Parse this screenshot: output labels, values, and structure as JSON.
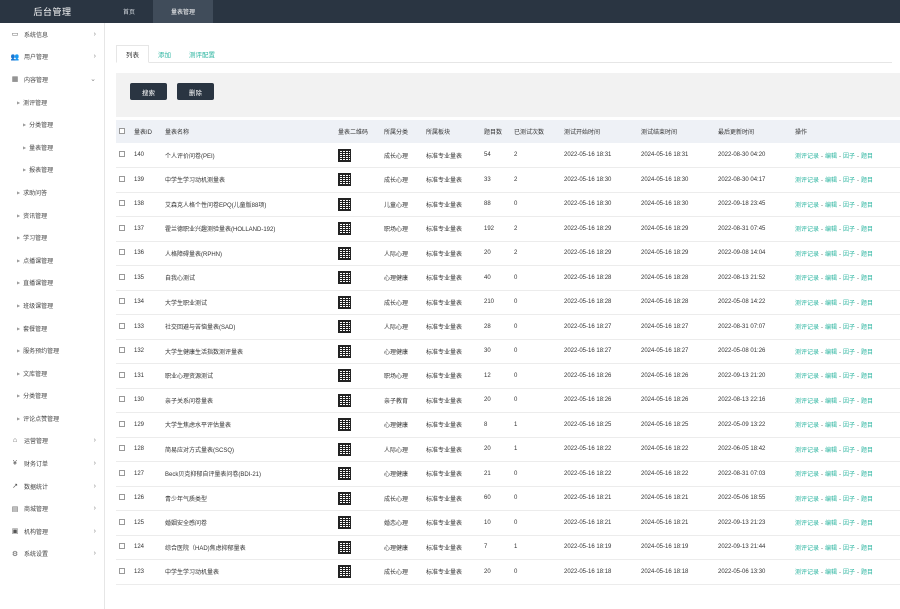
{
  "brand": "后台管理",
  "top_tabs": [
    "首页",
    "量表管理"
  ],
  "sidebar": {
    "top": [
      {
        "label": "系统信息",
        "icon": "monitor-icon",
        "glyph": "▭"
      },
      {
        "label": "用户管理",
        "icon": "users-icon",
        "glyph": "👥"
      },
      {
        "label": "内容管理",
        "icon": "grid-icon",
        "glyph": "▦"
      }
    ],
    "content_children": [
      {
        "label": "测评管理",
        "level": 1
      },
      {
        "label": "分类管理",
        "level": 2
      },
      {
        "label": "量表管理",
        "level": 2
      },
      {
        "label": "报表管理",
        "level": 2
      },
      {
        "label": "求助问答",
        "level": 1
      },
      {
        "label": "资讯管理",
        "level": 1
      },
      {
        "label": "学习管理",
        "level": 1
      },
      {
        "label": "点播课管理",
        "level": 1
      },
      {
        "label": "直播课管理",
        "level": 1
      },
      {
        "label": "班级课管理",
        "level": 1
      },
      {
        "label": "套餐管理",
        "level": 1
      },
      {
        "label": "服务预约管理",
        "level": 1
      },
      {
        "label": "文库管理",
        "level": 1
      },
      {
        "label": "分类管理",
        "level": 1
      },
      {
        "label": "评论点赞管理",
        "level": 1
      }
    ],
    "bottom": [
      {
        "label": "运营管理",
        "icon": "chart-icon",
        "glyph": "⌂"
      },
      {
        "label": "财务订单",
        "icon": "yen-icon",
        "glyph": "¥"
      },
      {
        "label": "数据统计",
        "icon": "stats-icon",
        "glyph": "↗"
      },
      {
        "label": "商城管理",
        "icon": "cart-icon",
        "glyph": "▤"
      },
      {
        "label": "机构管理",
        "icon": "building-icon",
        "glyph": "▣"
      },
      {
        "label": "系统设置",
        "icon": "gear-icon",
        "glyph": "⚙"
      }
    ]
  },
  "sub_tabs": [
    "列表",
    "添加",
    "测评配置"
  ],
  "toolbar": {
    "search_label": "搜索",
    "delete_label": "删除"
  },
  "table": {
    "headers": [
      "量表ID",
      "量表名称",
      "量表二维码",
      "所属分类",
      "所属板块",
      "题目数",
      "已测试次数",
      "测试开始时间",
      "测试结束时间",
      "最后更新时间",
      "操作"
    ],
    "ops": [
      "测评记录",
      "编辑",
      "因子",
      "题目"
    ],
    "rows": [
      [
        "140",
        "个人评价问卷(PEI)",
        "成长心理",
        "标准专业量表",
        "54",
        "2",
        "2022-05-16 18:31",
        "2024-05-16 18:31",
        "2022-08-30 04:20"
      ],
      [
        "139",
        "中学生学习动机测量表",
        "成长心理",
        "标准专业量表",
        "33",
        "2",
        "2022-05-16 18:30",
        "2024-05-16 18:30",
        "2022-08-30 04:17"
      ],
      [
        "138",
        "艾森克人格个性问卷EPQ(儿童版88项)",
        "儿童心理",
        "标准专业量表",
        "88",
        "0",
        "2022-05-16 18:30",
        "2024-05-16 18:30",
        "2022-09-18 23:45"
      ],
      [
        "137",
        "霍兰德职业兴趣测验量表(HOLLAND-192)",
        "职场心理",
        "标准专业量表",
        "192",
        "2",
        "2022-05-16 18:29",
        "2024-05-16 18:29",
        "2022-08-31 07:45"
      ],
      [
        "136",
        "人格障碍量表(RPHN)",
        "人际心理",
        "标准专业量表",
        "20",
        "2",
        "2022-05-16 18:29",
        "2024-05-16 18:29",
        "2022-09-08 14:04"
      ],
      [
        "135",
        "自我心测试",
        "心理健康",
        "标准专业量表",
        "40",
        "0",
        "2022-05-16 18:28",
        "2024-05-16 18:28",
        "2022-08-13 21:52"
      ],
      [
        "134",
        "大学生职业测试",
        "成长心理",
        "标准专业量表",
        "210",
        "0",
        "2022-05-16 18:28",
        "2024-05-16 18:28",
        "2022-05-08 14:22"
      ],
      [
        "133",
        "社交回避与苦恼量表(SAD)",
        "人际心理",
        "标准专业量表",
        "28",
        "0",
        "2022-05-16 18:27",
        "2024-05-16 18:27",
        "2022-08-31 07:07"
      ],
      [
        "132",
        "大学生健康生活指数测评量表",
        "心理健康",
        "标准专业量表",
        "30",
        "0",
        "2022-05-16 18:27",
        "2024-05-16 18:27",
        "2022-05-08 01:26"
      ],
      [
        "131",
        "职业心理资源测试",
        "职场心理",
        "标准专业量表",
        "12",
        "0",
        "2022-05-16 18:26",
        "2024-05-16 18:26",
        "2022-09-13 21:20"
      ],
      [
        "130",
        "亲子关系问卷量表",
        "亲子教育",
        "标准专业量表",
        "20",
        "0",
        "2022-05-16 18:26",
        "2024-05-16 18:26",
        "2022-08-13 22:16"
      ],
      [
        "129",
        "大学生焦虑水平评估量表",
        "心理健康",
        "标准专业量表",
        "8",
        "1",
        "2022-05-16 18:25",
        "2024-05-16 18:25",
        "2022-05-09 13:22"
      ],
      [
        "128",
        "简易应对方式量表(SCSQ)",
        "人际心理",
        "标准专业量表",
        "20",
        "1",
        "2022-05-16 18:22",
        "2024-05-16 18:22",
        "2022-06-05 18:42"
      ],
      [
        "127",
        "Beck贝克抑郁自评量表问卷(BDI-21)",
        "心理健康",
        "标准专业量表",
        "21",
        "0",
        "2022-05-16 18:22",
        "2024-05-16 18:22",
        "2022-08-31 07:03"
      ],
      [
        "126",
        "青少年气质类型",
        "成长心理",
        "标准专业量表",
        "60",
        "0",
        "2022-05-16 18:21",
        "2024-05-16 18:21",
        "2022-05-06 18:55"
      ],
      [
        "125",
        "婚姻安全感问卷",
        "婚恋心理",
        "标准专业量表",
        "10",
        "0",
        "2022-05-16 18:21",
        "2024-05-16 18:21",
        "2022-09-13 21:23"
      ],
      [
        "124",
        "综合医院（HAD)焦虑抑郁量表",
        "心理健康",
        "标准专业量表",
        "7",
        "1",
        "2022-05-16 18:19",
        "2024-05-16 18:19",
        "2022-09-13 21:44"
      ],
      [
        "123",
        "中学生学习动机量表",
        "成长心理",
        "标准专业量表",
        "20",
        "0",
        "2022-05-16 18:18",
        "2024-05-16 18:18",
        "2022-05-06 13:30"
      ]
    ]
  }
}
